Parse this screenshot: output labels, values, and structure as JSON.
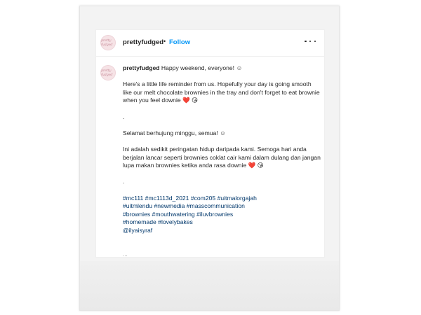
{
  "post": {
    "username": "prettyfudged",
    "separator": "•",
    "follow_label": "Follow",
    "avatar_text": "pretty fudged",
    "caption_user": "prettyfudged",
    "caption_lead": "Happy weekend, everyone! ☺",
    "para1": "Here's a little life reminder from us. Hopefully your day is going smooth like our melt chocolate brownies in the tray and don't forget to eat brownie when you feel downie",
    "emoji_heart": "❤️",
    "emoji_kiss": "😘",
    "dot1": ".",
    "para2": "Selamat berhujung minggu, semua! ☺",
    "para3": "Ini adalah sedikit peringatan hidup daripada kami. Semoga hari anda berjalan lancar seperti brownies coklat cair kami dalam dulang dan jangan lupa makan brownies ketika anda rasa downie",
    "dot2": ".",
    "hashtags": [
      "#mc111 #mc1113d_2021 #com205 #uitmalorgajah",
      "#uitmlendu #newmedia #masscommunication",
      "#brownies #mouthwatering #iluvbrownies",
      "#homemade #lovelybakes",
      "@ilyaisyraf"
    ],
    "truncation": "..."
  }
}
